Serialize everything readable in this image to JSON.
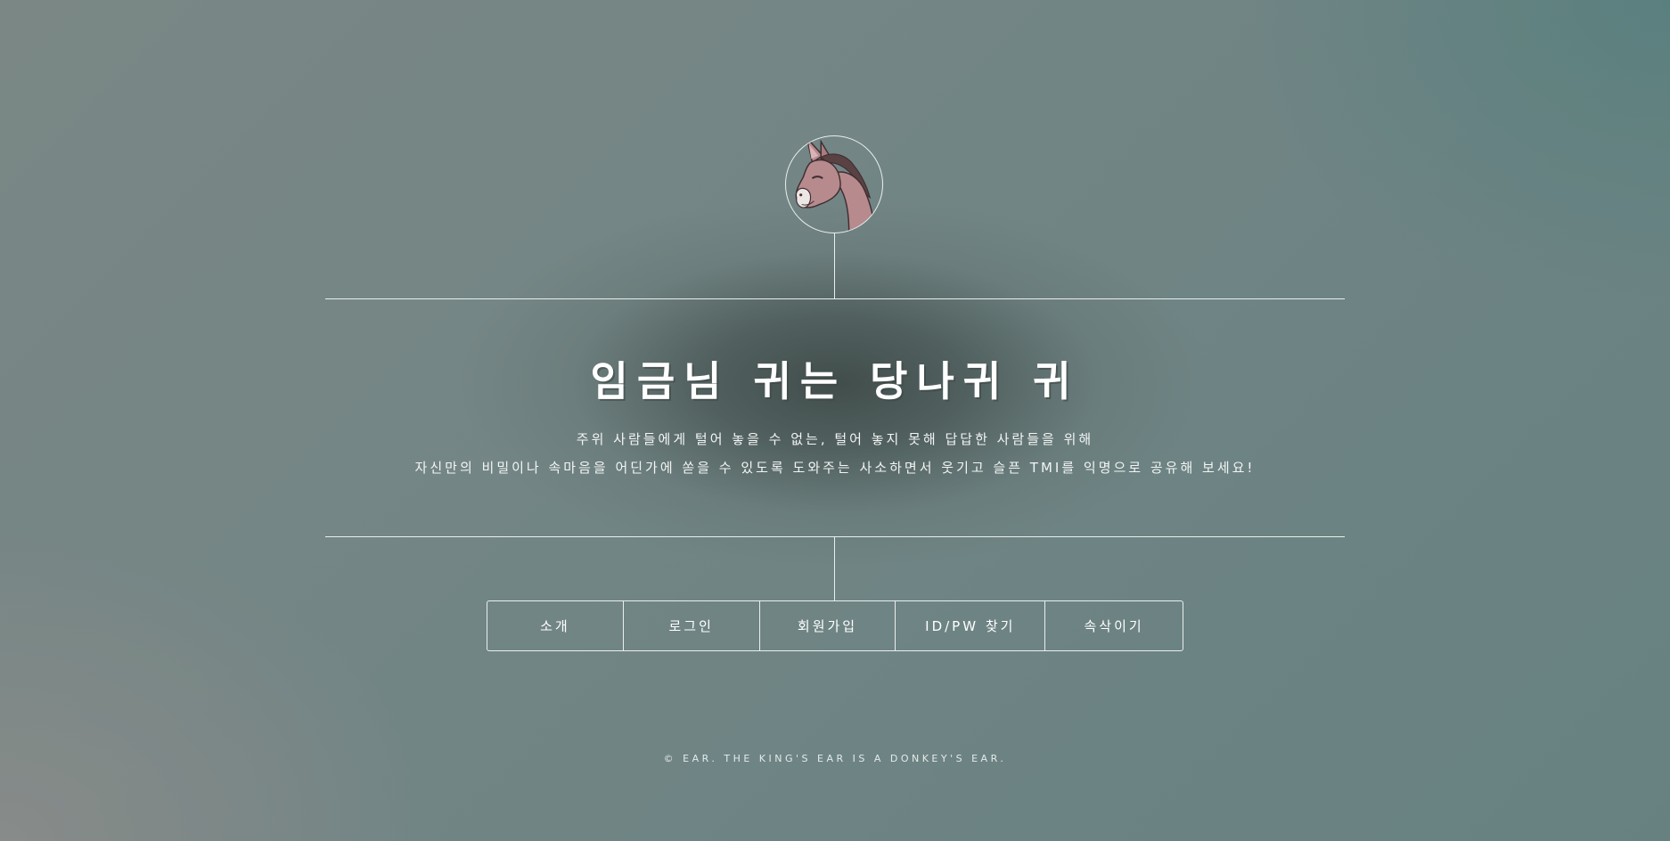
{
  "logo": {
    "icon": "donkey-icon"
  },
  "header": {
    "title": "임금님 귀는 당나귀 귀",
    "description_line1": "주위 사람들에게 털어 놓을 수 없는, 털어 놓지 못해 답답한 사람들을 위해",
    "description_line2": "자신만의 비밀이나 속마음을 어딘가에 쏟을 수 있도록 도와주는 사소하면서 웃기고 슬픈 TMI를 익명으로 공유해 보세요!"
  },
  "nav": {
    "items": [
      {
        "label": "소개"
      },
      {
        "label": "로그인"
      },
      {
        "label": "회원가입"
      },
      {
        "label": "ID/PW 찾기"
      },
      {
        "label": "속삭이기"
      }
    ]
  },
  "footer": {
    "copyright": "© EAR. THE KING'S EAR IS A DONKEY'S EAR."
  },
  "colors": {
    "line": "#e9efee",
    "text": "#ffffff",
    "donkey_body": "#b78a8e",
    "donkey_mane": "#5a4244"
  }
}
